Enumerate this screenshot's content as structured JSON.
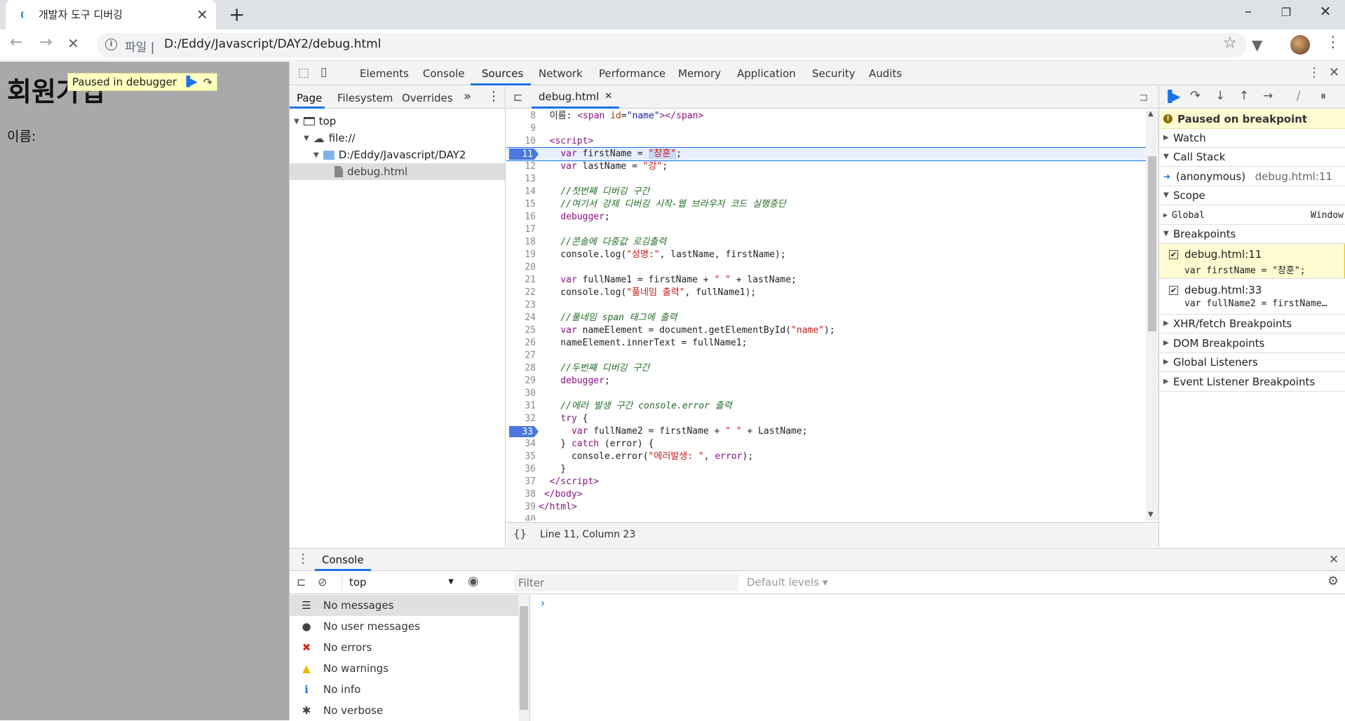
{
  "browser": {
    "tab_title": "개발자 도구 디버깅",
    "new_tab": "+",
    "url_scheme": "파일 |",
    "url_path": "D:/Eddy/Javascript/DAY2/debug.html"
  },
  "page": {
    "heading": "회원가입",
    "label": "이름:",
    "paused_badge": "Paused in debugger"
  },
  "devtools": {
    "tabs": [
      "Elements",
      "Console",
      "Sources",
      "Network",
      "Performance",
      "Memory",
      "Application",
      "Security",
      "Audits"
    ],
    "active_tab": "Sources",
    "navigator": {
      "tabs": [
        "Page",
        "Filesystem",
        "Overrides"
      ],
      "tree": [
        "top",
        "file://",
        "D:/Eddy/Javascript/DAY2",
        "debug.html"
      ]
    },
    "editor": {
      "file_tab": "debug.html",
      "status": "Line 11, Column 23",
      "lines": [
        {
          "n": "8",
          "html": "<span class=\"tx\">  이름: </span><span class=\"tg\">&lt;span</span> <span class=\"at\">id</span>=<span class=\"av\">\"name\"</span><span class=\"tg\">&gt;&lt;/span&gt;</span>"
        },
        {
          "n": "9",
          "html": ""
        },
        {
          "n": "10",
          "html": "  <span class=\"tg\">&lt;script&gt;</span>"
        },
        {
          "n": "11",
          "html": "    <span class=\"kw\">var</span> firstName = <span class=\"str\" style=\"background:#c8d8f8\">\"창훈\"</span>;"
        },
        {
          "n": "12",
          "html": "    <span class=\"kw\">var</span> lastName = <span class=\"str\">\"강\"</span>;"
        },
        {
          "n": "13",
          "html": ""
        },
        {
          "n": "14",
          "html": "    <span class=\"cm\">//첫번째 디버깅 구간</span>"
        },
        {
          "n": "15",
          "html": "    <span class=\"cm\">//여기서 강제 디버깅 시작-웹 브라우저 코드 실행중단</span>"
        },
        {
          "n": "16",
          "html": "    <span class=\"kw\">debugger</span>;"
        },
        {
          "n": "17",
          "html": ""
        },
        {
          "n": "18",
          "html": "    <span class=\"cm\">//콘솔에 다중값 로깅출력</span>"
        },
        {
          "n": "19",
          "html": "    console.log(<span class=\"str\">\"성명:\"</span>, lastName, firstName);"
        },
        {
          "n": "20",
          "html": ""
        },
        {
          "n": "21",
          "html": "    <span class=\"kw\">var</span> fullName1 = firstName + <span class=\"str\">\" \"</span> + lastName;"
        },
        {
          "n": "22",
          "html": "    console.log(<span class=\"str\">\"풀네임 출력\"</span>, fullName1);"
        },
        {
          "n": "23",
          "html": ""
        },
        {
          "n": "24",
          "html": "    <span class=\"cm\">//풀네임 span 태그에 출력</span>"
        },
        {
          "n": "25",
          "html": "    <span class=\"kw\">var</span> nameElement = document.getElementById(<span class=\"str\">\"name\"</span>);"
        },
        {
          "n": "26",
          "html": "    nameElement.innerText = fullName1;"
        },
        {
          "n": "27",
          "html": ""
        },
        {
          "n": "28",
          "html": "    <span class=\"cm\">//두번째 디버깅 구간</span>"
        },
        {
          "n": "29",
          "html": "    <span class=\"kw\">debugger</span>;"
        },
        {
          "n": "30",
          "html": ""
        },
        {
          "n": "31",
          "html": "    <span class=\"cm\">//에러 발생 구간 console.error 출력</span>"
        },
        {
          "n": "32",
          "html": "    <span class=\"kw\">try</span> {"
        },
        {
          "n": "33",
          "html": "      <span class=\"kw\">var</span> fullName2 = firstName + <span class=\"str\">\" \"</span> + LastName;"
        },
        {
          "n": "34",
          "html": "    } <span class=\"kw\">catch</span> (error) {"
        },
        {
          "n": "35",
          "html": "      console.error(<span class=\"str\">\"에러발생: \"</span>, <span class=\"kw\">error</span>);"
        },
        {
          "n": "36",
          "html": "    }"
        },
        {
          "n": "37",
          "html": "  <span class=\"tg\">&lt;/script&gt;</span>"
        },
        {
          "n": "38",
          "html": " <span class=\"tg\">&lt;/body&gt;</span>"
        },
        {
          "n": "39",
          "html": "<span class=\"tg\">&lt;/html&gt;</span>"
        },
        {
          "n": "40",
          "html": ""
        }
      ]
    },
    "debugger": {
      "paused_message": "Paused on breakpoint",
      "watch": "Watch",
      "call_stack": "Call Stack",
      "call_frame": "(anonymous)",
      "call_frame_loc": "debug.html:11",
      "scope": "Scope",
      "global": "Global",
      "global_value": "Window",
      "breakpoints": "Breakpoints",
      "bp1_loc": "debug.html:11",
      "bp1_code": "var firstName = \"창훈\";",
      "bp2_loc": "debug.html:33",
      "bp2_code": "var fullName2 = firstName…",
      "xhr": "XHR/fetch Breakpoints",
      "dom": "DOM Breakpoints",
      "global_listeners": "Global Listeners",
      "event_listeners": "Event Listener Breakpoints"
    },
    "drawer": {
      "tab": "Console",
      "context": "top",
      "filter_placeholder": "Filter",
      "levels": "Default levels ▾",
      "prompt": "›",
      "messages": [
        {
          "label": "No messages",
          "icon": "list-icon"
        },
        {
          "label": "No user messages",
          "icon": "user-icon"
        },
        {
          "label": "No errors",
          "icon": "error-icon"
        },
        {
          "label": "No warnings",
          "icon": "warning-icon"
        },
        {
          "label": "No info",
          "icon": "info-icon"
        },
        {
          "label": "No verbose",
          "icon": "bug-icon"
        }
      ]
    }
  },
  "colors": {
    "accent": "#1a73e8",
    "breakpoint": "#4a78e0",
    "paused_bg": "#fffbd1"
  }
}
